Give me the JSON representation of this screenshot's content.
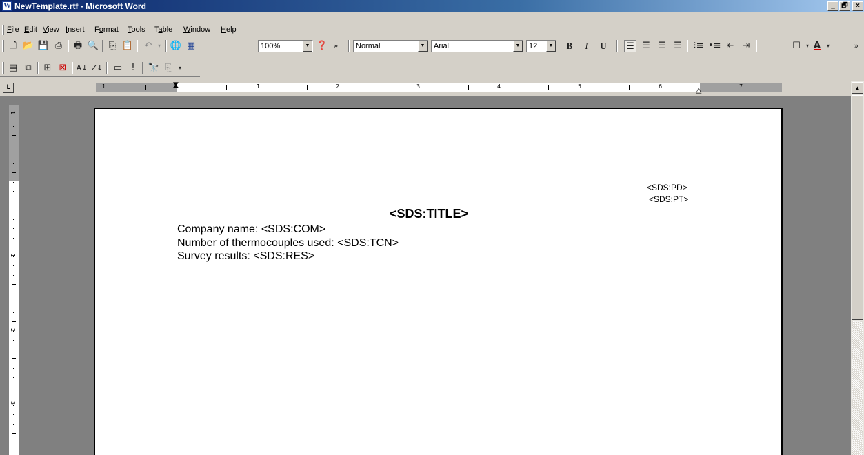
{
  "window": {
    "title": "NewTemplate.rtf - Microsoft Word",
    "minimize": "_",
    "maximize": "🗗",
    "close": "×"
  },
  "menu": [
    {
      "accel": "F",
      "rest": "ile"
    },
    {
      "accel": "E",
      "rest": "dit"
    },
    {
      "accel": "V",
      "rest": "iew"
    },
    {
      "accel": "I",
      "rest": "nsert"
    },
    {
      "pre": "F",
      "accel": "o",
      "rest": "rmat"
    },
    {
      "accel": "T",
      "rest": "ools"
    },
    {
      "pre": "T",
      "accel": "a",
      "rest": "ble"
    },
    {
      "accel": "W",
      "rest": "indow"
    },
    {
      "accel": "H",
      "rest": "elp"
    }
  ],
  "toolbar": {
    "zoom": "100%",
    "style": "Normal",
    "font": "Arial",
    "size": "12",
    "bold": "B",
    "italic": "I",
    "underline": "U",
    "more": "»"
  },
  "ruler": {
    "labels": [
      "1",
      "1",
      "2",
      "3",
      "4",
      "5",
      "6",
      "7"
    ],
    "vlabels": [
      "1",
      "1",
      "2",
      "3"
    ]
  },
  "document": {
    "header_date": "<SDS:PD>",
    "header_time": "<SDS:PT>",
    "title": "<SDS:TITLE>",
    "line1": "Company name: <SDS:COM>",
    "line2": "Number of thermocouples used: <SDS:TCN>",
    "line3": "Survey results: <SDS:RES>"
  },
  "icons": [
    "new-document-icon",
    "open-folder-icon",
    "save-icon",
    "permission-icon",
    "print-icon",
    "print-preview-icon",
    "copy-icon",
    "paste-icon",
    "undo-icon",
    "web-icon",
    "table-icon",
    "help-icon"
  ]
}
